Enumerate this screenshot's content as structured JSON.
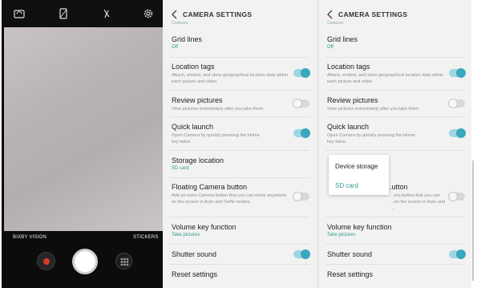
{
  "camera": {
    "top_icons": [
      "camera-switch-icon",
      "flash-off-icon",
      "timer-off-icon",
      "settings-gear-icon"
    ],
    "left_label": "BIXBY VISION",
    "right_label": "STICKERS",
    "buttons": [
      "record-button",
      "shutter-button",
      "effects-button"
    ],
    "colors": {
      "record": "#d63b2a"
    }
  },
  "left_panel": {
    "title": "CAMERA SETTINGS",
    "partial_label": "Contours",
    "items": [
      {
        "title": "Grid lines",
        "sub": "Off"
      },
      {
        "title": "Location tags",
        "desc": "Attach, embed, and store geographical location data within each picture and video.",
        "toggle": true
      },
      {
        "title": "Review pictures",
        "desc": "View pictures immediately after you take them.",
        "toggle": false
      },
      {
        "title": "Quick launch",
        "desc": "Open Camera by quickly pressing the Home key twice.",
        "toggle": true
      },
      {
        "title": "Storage location",
        "sub": "SD card"
      },
      {
        "title": "Floating Camera button",
        "desc": "Add an extra Camera button that you can move anywhere on the screen in Auto and Selfie modes.",
        "toggle": false
      },
      {
        "title": "Volume key function",
        "sub": "Take pictures"
      },
      {
        "title": "Shutter sound",
        "toggle": true
      },
      {
        "title": "Reset settings"
      }
    ]
  },
  "right_panel": {
    "title": "CAMERA SETTINGS",
    "partial_label": "Contours",
    "items": [
      {
        "title": "Grid lines",
        "sub": "Off"
      },
      {
        "title": "Location tags",
        "desc": "Attach, embed, and store geographical location data within each picture and video.",
        "toggle": true
      },
      {
        "title": "Review pictures",
        "desc": "View pictures immediately after you take them.",
        "toggle": false
      },
      {
        "title": "Quick launch",
        "desc": "Open Camera by quickly pressing the Home key twice.",
        "toggle": true
      },
      {
        "title": "...utton",
        "desc": "...era button that you can ...on the screen in Auto and ...",
        "toggle": false
      },
      {
        "title": "Volume key function",
        "sub": "Take pictures"
      },
      {
        "title": "Shutter sound",
        "toggle": true
      },
      {
        "title": "Reset settings"
      }
    ],
    "popup": {
      "options": [
        "Device storage",
        "SD card"
      ],
      "selected": "SD card"
    }
  },
  "colors": {
    "accent": "#2e9c8a",
    "toggle_on": "#3aa8bc"
  }
}
